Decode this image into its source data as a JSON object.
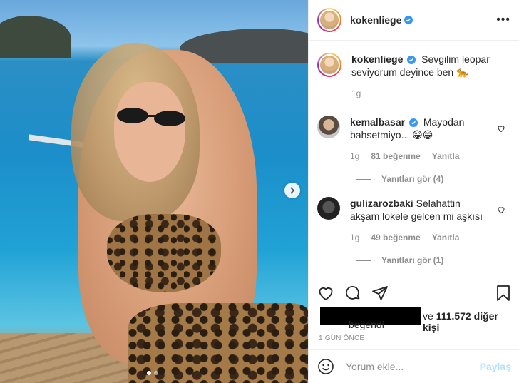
{
  "post": {
    "username": "kokenliege",
    "caption_text": "Sevgilim leopar seviyorum deyince ben 🐆",
    "caption_age": "1g"
  },
  "comments": [
    {
      "username": "kemalbasar",
      "verified": true,
      "text": "Mayodan bahsetmiyo... 😁😁",
      "age": "1g",
      "likes": "81 beğenme",
      "reply_label": "Yanıtla",
      "view_replies": "Yanıtları gör (4)"
    },
    {
      "username": "gulizarozbaki",
      "verified": false,
      "text": "Selahattin akşam lokele gelcen mi aşkısı",
      "age": "1g",
      "likes": "49 beğenme",
      "reply_label": "Yanıtla",
      "view_replies": "Yanıtları gör (1)"
    }
  ],
  "likes": {
    "suffix": "ve",
    "count": "111.572 diğer kişi",
    "liked_label": "beğendi"
  },
  "timestamp": "1 GÜN ÖNCE",
  "add_comment": {
    "placeholder": "Yorum ekle...",
    "post_label": "Paylaş"
  },
  "colors": {
    "verified": "#3897f0",
    "post_button": "#b2dffc",
    "secondary_text": "#8e8e8e"
  }
}
